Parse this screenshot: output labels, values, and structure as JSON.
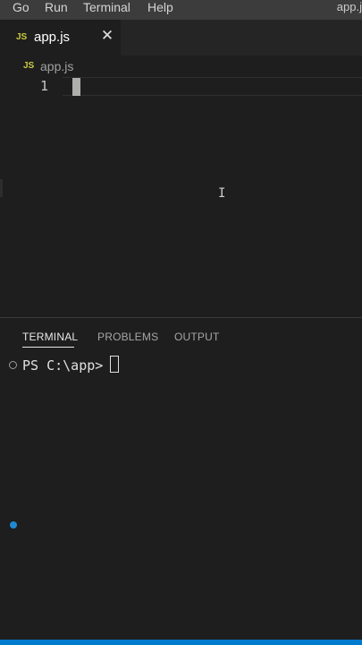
{
  "menubar": {
    "items": [
      "Go",
      "Run",
      "Terminal",
      "Help"
    ],
    "window_title": "app.j"
  },
  "editor": {
    "tab": {
      "label": "app.js",
      "icon_text": "JS",
      "close_glyph": "✕"
    },
    "breadcrumb": {
      "label": "app.js",
      "icon_text": "JS"
    },
    "line_number": "1",
    "mouse_cursor": "I"
  },
  "panel": {
    "tabs": [
      "TERMINAL",
      "PROBLEMS",
      "OUTPUT"
    ],
    "active_tab": "TERMINAL",
    "prompt": "PS C:\\app> "
  },
  "colors": {
    "accent": "#007acc",
    "js_icon": "#cbcb41",
    "background": "#1e1e1e",
    "menubar": "#3c3c3c"
  }
}
